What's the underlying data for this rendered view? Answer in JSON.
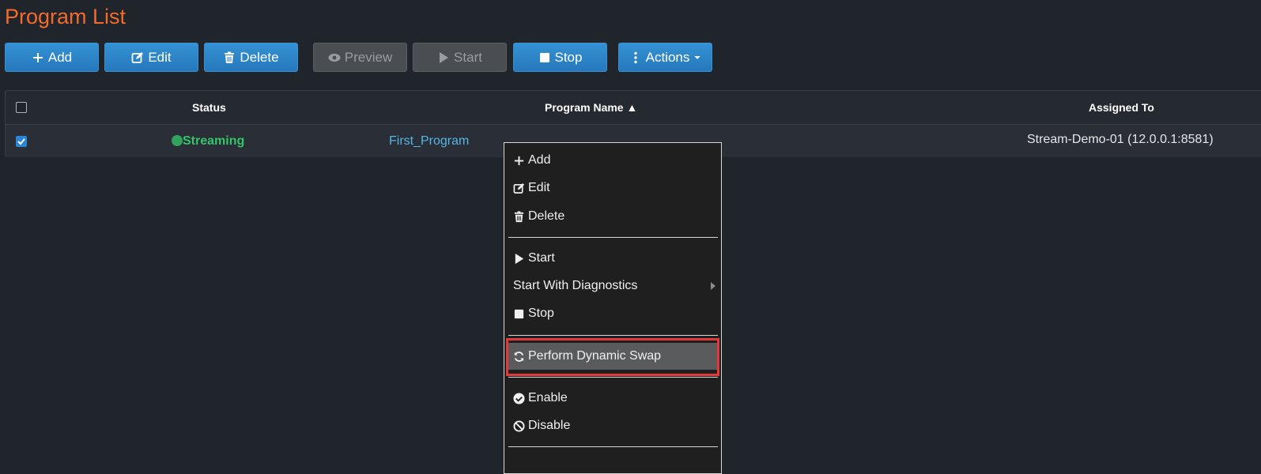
{
  "page": {
    "title": "Program List"
  },
  "toolbar": {
    "add": "Add",
    "edit": "Edit",
    "delete": "Delete",
    "preview": "Preview",
    "start": "Start",
    "stop": "Stop",
    "actions": "Actions"
  },
  "table": {
    "headers": {
      "status": "Status",
      "program_name": "Program Name ▲",
      "assigned_to": "Assigned To"
    },
    "rows": [
      {
        "selected": true,
        "status": "Streaming",
        "program_name": "First_Program",
        "assigned_to": "Stream-Demo-01 (12.0.0.1:8581)"
      }
    ]
  },
  "context_menu": {
    "add": "Add",
    "edit": "Edit",
    "delete": "Delete",
    "start": "Start",
    "start_with_diagnostics": "Start With Diagnostics",
    "stop": "Stop",
    "perform_dynamic_swap": "Perform Dynamic Swap",
    "enable": "Enable",
    "disable": "Disable"
  },
  "colors": {
    "title": "#f46a2a",
    "button": "#2a80c4",
    "status_streaming": "#35c46a",
    "link": "#56b4e6",
    "highlight_border": "#e03a3a"
  }
}
